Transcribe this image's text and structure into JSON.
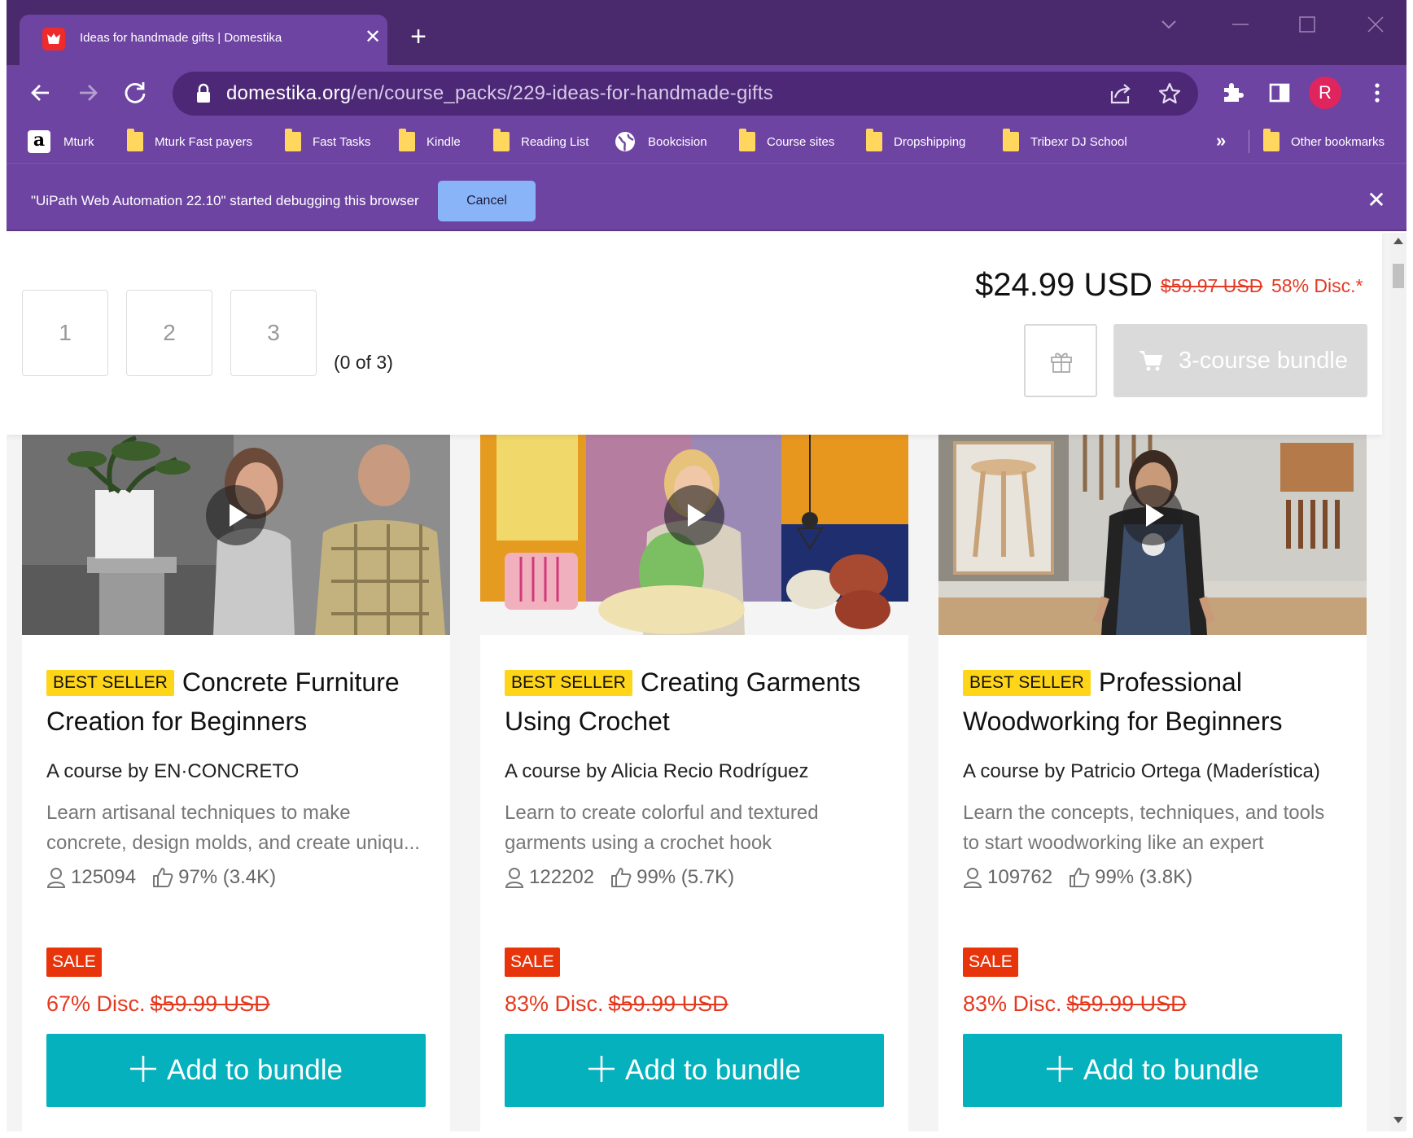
{
  "browser": {
    "tab": {
      "title": "Ideas for handmade gifts | Domestika"
    },
    "url": {
      "host": "domestika.org",
      "path": "/en/course_packs/229-ideas-for-handmade-gifts"
    },
    "profile_initial": "R",
    "bookmarks": [
      {
        "label": "Mturk",
        "icon": "amazon-icon"
      },
      {
        "label": "Mturk Fast payers",
        "icon": "folder-icon"
      },
      {
        "label": "Fast Tasks",
        "icon": "folder-icon"
      },
      {
        "label": "Kindle",
        "icon": "folder-icon"
      },
      {
        "label": "Reading List",
        "icon": "folder-icon"
      },
      {
        "label": "Bookcision",
        "icon": "globe-icon"
      },
      {
        "label": "Course sites",
        "icon": "folder-icon"
      },
      {
        "label": "Dropshipping",
        "icon": "folder-icon"
      },
      {
        "label": "Tribexr DJ School",
        "icon": "folder-icon"
      }
    ],
    "bookmarks_overflow": "»",
    "other_bookmarks": "Other bookmarks",
    "infobar": {
      "text": "\"UiPath Web Automation 22.10\" started debugging this browser",
      "cancel_label": "Cancel"
    }
  },
  "bundle": {
    "slots": [
      "1",
      "2",
      "3"
    ],
    "count_text": "(0 of 3)",
    "price": "$24.99 USD",
    "old_price": "$59.97 USD",
    "discount": "58% Disc.*",
    "button_label": "3-course bundle"
  },
  "courses": [
    {
      "badge": "BEST SELLER",
      "title": "Concrete Furniture Creation for Beginners",
      "author": "A course by EN·CONCRETO",
      "description": "Learn artisanal techniques to make concrete, design molds, and create uniqu...",
      "students": "125094",
      "rating": "97% (3.4K)",
      "sale_badge": "SALE",
      "discount": "67% Disc.",
      "old_price": "$59.99 USD",
      "button_label": "Add to bundle"
    },
    {
      "badge": "BEST SELLER",
      "title": "Creating Garments Using Crochet",
      "author": "A course by Alicia Recio Rodríguez",
      "description": "Learn to create colorful and textured garments using a crochet hook",
      "students": "122202",
      "rating": "99% (5.7K)",
      "sale_badge": "SALE",
      "discount": "83% Disc.",
      "old_price": "$59.99 USD",
      "button_label": "Add to bundle"
    },
    {
      "badge": "BEST SELLER",
      "title": "Professional Woodworking for Beginners",
      "author": "A course by Patricio Ortega (Maderística)",
      "description": "Learn the concepts, techniques, and tools to start woodworking like an expert",
      "students": "109762",
      "rating": "99% (3.8K)",
      "sale_badge": "SALE",
      "discount": "83% Disc.",
      "old_price": "$59.99 USD",
      "button_label": "Add to bundle"
    }
  ],
  "colors": {
    "tab_strip": "#4a2a6c",
    "toolbar": "#6e44a3",
    "accent_button": "#05b1bd",
    "sale_red": "#e8340b",
    "best_seller_yellow": "#ffd51a"
  }
}
